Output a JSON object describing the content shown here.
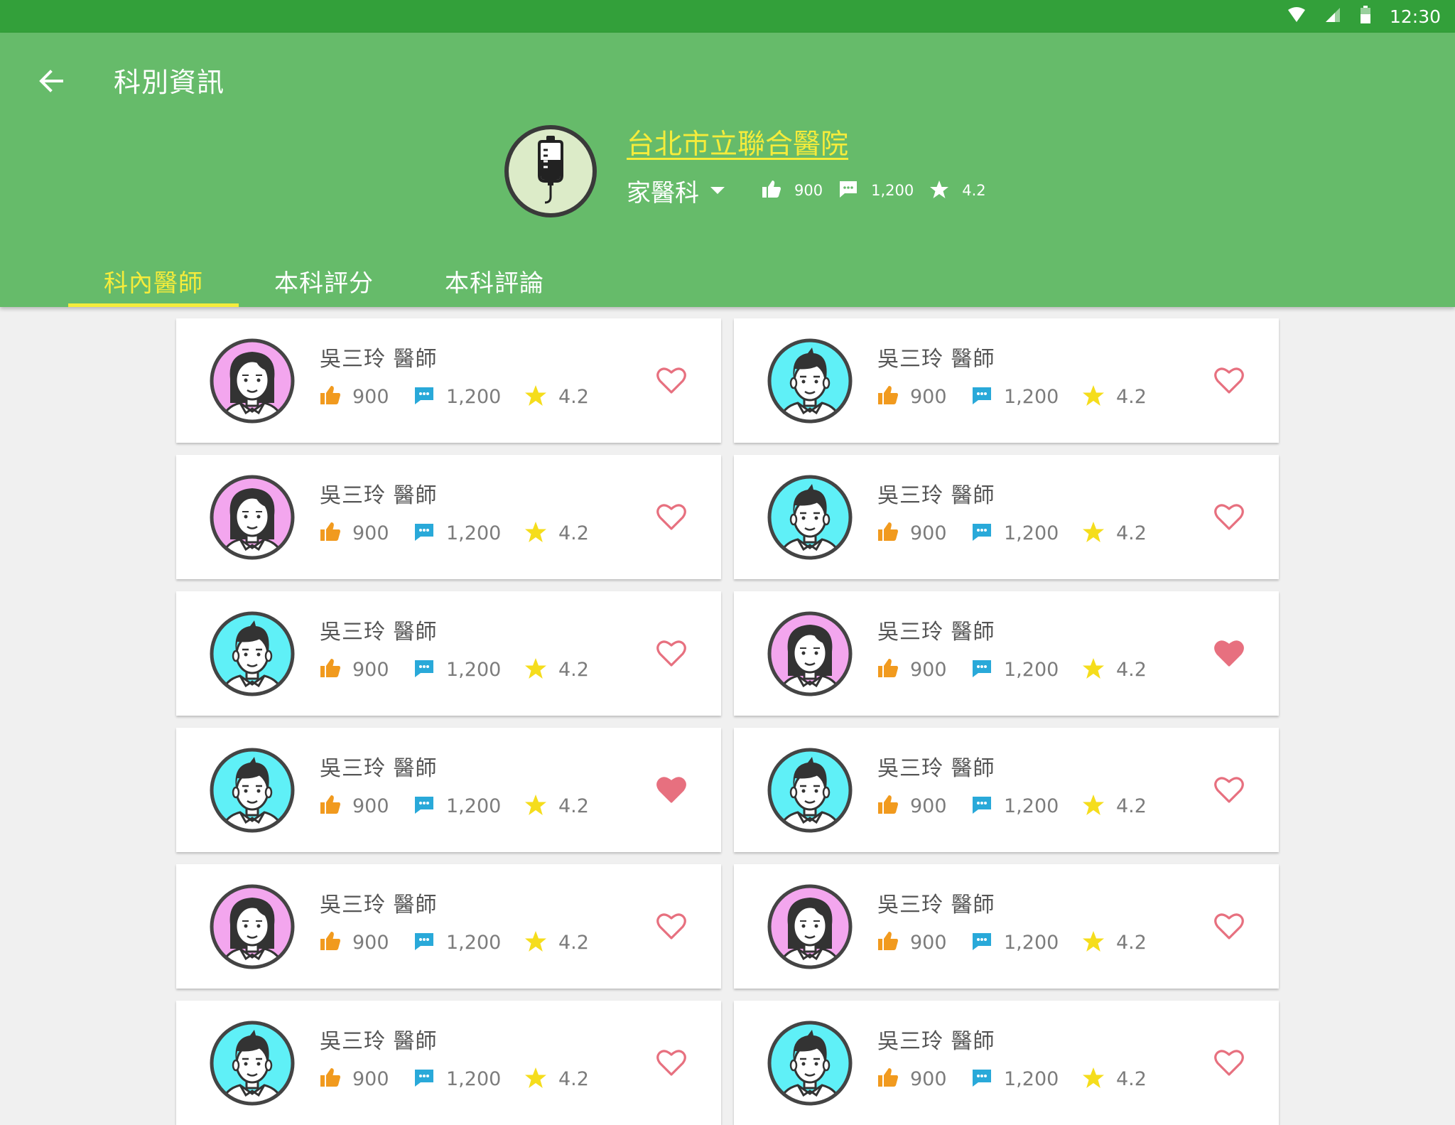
{
  "status_bar": {
    "time": "12:30",
    "icons": [
      "wifi-icon",
      "cellular-signal-icon",
      "battery-icon"
    ]
  },
  "app_bar": {
    "title": "科別資訊",
    "back_icon": "arrow-back-icon"
  },
  "hospital": {
    "name": "台北市立聯合醫院",
    "logo_icon": "iv-bag-icon",
    "department": "家醫科",
    "likes": "900",
    "comments": "1,200",
    "rating": "4.2"
  },
  "tabs": [
    {
      "label": "科內醫師",
      "active": true
    },
    {
      "label": "本科評分",
      "active": false
    },
    {
      "label": "本科評論",
      "active": false
    }
  ],
  "colors": {
    "status_bar": "#33a03a",
    "app_bar": "#66bb6a",
    "accent_yellow": "#f5ec3b",
    "like_orange": "#f19a1e",
    "comment_blue": "#29a9d9",
    "star_yellow": "#f5dd1c",
    "heart_pink": "#e7707f",
    "avatar_female_bg": "#f3a6ee",
    "avatar_male_bg": "#5ff0f7"
  },
  "doctors": [
    {
      "name": "吳三玲 醫師",
      "likes": "900",
      "comments": "1,200",
      "rating": "4.2",
      "avatar": "female",
      "favorite": false
    },
    {
      "name": "吳三玲 醫師",
      "likes": "900",
      "comments": "1,200",
      "rating": "4.2",
      "avatar": "male",
      "favorite": false
    },
    {
      "name": "吳三玲 醫師",
      "likes": "900",
      "comments": "1,200",
      "rating": "4.2",
      "avatar": "female",
      "favorite": false
    },
    {
      "name": "吳三玲 醫師",
      "likes": "900",
      "comments": "1,200",
      "rating": "4.2",
      "avatar": "male",
      "favorite": false
    },
    {
      "name": "吳三玲 醫師",
      "likes": "900",
      "comments": "1,200",
      "rating": "4.2",
      "avatar": "male",
      "favorite": false
    },
    {
      "name": "吳三玲 醫師",
      "likes": "900",
      "comments": "1,200",
      "rating": "4.2",
      "avatar": "female",
      "favorite": true
    },
    {
      "name": "吳三玲 醫師",
      "likes": "900",
      "comments": "1,200",
      "rating": "4.2",
      "avatar": "male",
      "favorite": true
    },
    {
      "name": "吳三玲 醫師",
      "likes": "900",
      "comments": "1,200",
      "rating": "4.2",
      "avatar": "male",
      "favorite": false
    },
    {
      "name": "吳三玲 醫師",
      "likes": "900",
      "comments": "1,200",
      "rating": "4.2",
      "avatar": "female",
      "favorite": false
    },
    {
      "name": "吳三玲 醫師",
      "likes": "900",
      "comments": "1,200",
      "rating": "4.2",
      "avatar": "female",
      "favorite": false
    },
    {
      "name": "吳三玲 醫師",
      "likes": "900",
      "comments": "1,200",
      "rating": "4.2",
      "avatar": "male",
      "favorite": false
    },
    {
      "name": "吳三玲 醫師",
      "likes": "900",
      "comments": "1,200",
      "rating": "4.2",
      "avatar": "male",
      "favorite": false
    }
  ]
}
